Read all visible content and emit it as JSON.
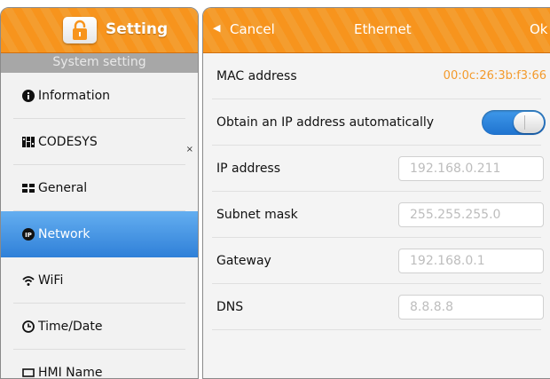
{
  "left": {
    "title": "Setting",
    "section": "System setting",
    "items": [
      {
        "label": "Information",
        "icon": "info-icon"
      },
      {
        "label": "CODESYS",
        "icon": "codesys-icon"
      },
      {
        "label": "General",
        "icon": "grid-icon"
      },
      {
        "label": "Network",
        "icon": "ip-icon",
        "active": true
      },
      {
        "label": "WiFi",
        "icon": "wifi-icon"
      },
      {
        "label": "Time/Date",
        "icon": "clock-icon"
      },
      {
        "label": "HMI Name",
        "icon": "hmi-icon"
      }
    ],
    "close_glyph": "×"
  },
  "right": {
    "back_glyph": "◀",
    "cancel": "Cancel",
    "title": "Ethernet",
    "ok": "Ok",
    "mac_label": "MAC address",
    "mac_value": "00:0c:26:3b:f3:66",
    "dhcp_label": "Obtain an IP address automatically",
    "dhcp_enabled": true,
    "fields": [
      {
        "label": "IP address",
        "value": "192.168.0.211"
      },
      {
        "label": "Subnet mask",
        "value": "255.255.255.0"
      },
      {
        "label": "Gateway",
        "value": "192.168.0.1"
      },
      {
        "label": "DNS",
        "value": "8.8.8.8"
      }
    ]
  },
  "colors": {
    "header_orange": "#f7941d",
    "active_blue": "#3a8ee0",
    "mac_orange": "#f39a2b"
  }
}
